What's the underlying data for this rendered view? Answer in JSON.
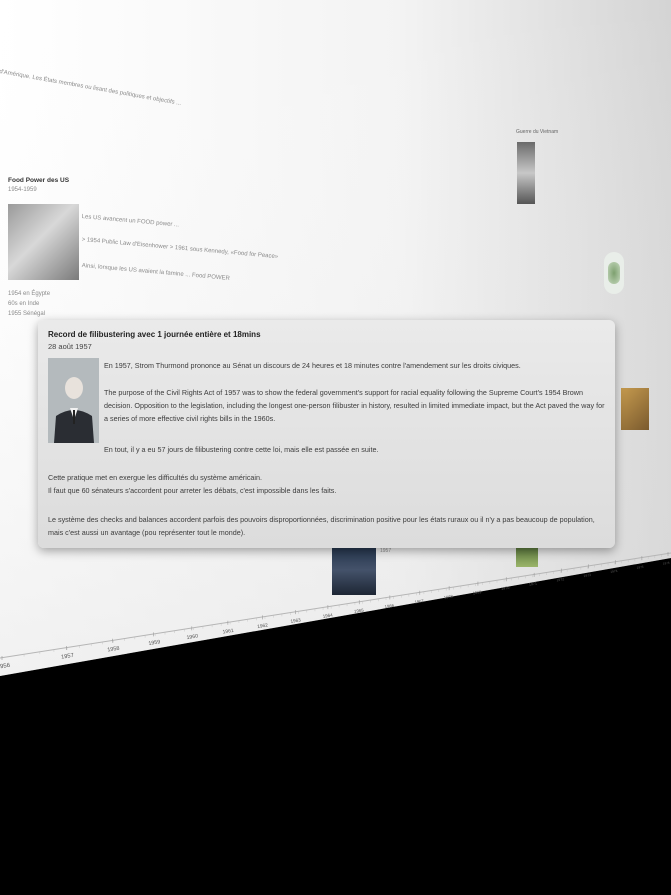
{
  "background": {
    "top_paragraph": "d'Amérique. Les États membres ou lisant des politiques et objectifs ...",
    "section_title": "Food Power des US",
    "section_years": "1954-1959",
    "section_text_1": "Les US avancent un FOOD power ...",
    "section_text_2": "> 1954 Public Law d'Eisenhower > 1961 sous Kennedy, «Food for Peace»",
    "section_text_3": "Ainsi, lorsque les US avaient la famine ... Food POWER",
    "left_list": [
      "1954 en Égypte",
      "60s en Inde",
      "1955 Sénégal"
    ],
    "right_title": "Guerre du Vietnam",
    "right_item_label": "1957"
  },
  "timeline": {
    "years": [
      "1956",
      "1957",
      "1958",
      "1959",
      "1960",
      "1961",
      "1962",
      "1963",
      "1964",
      "1965",
      "1966",
      "1967",
      "1968",
      "1969",
      "1970",
      "1971",
      "1972",
      "1973",
      "1974",
      "1975",
      "1976"
    ]
  },
  "card": {
    "title": "Record de filibustering avec 1 journée entière et 18mins",
    "date": "28 août 1957",
    "photo_icon": "portrait-photo",
    "paragraphs": [
      "En 1957, Strom Thurmond prononce au Sénat un discours de 24 heures et 18 minutes contre l'amendement sur les droits civiques.",
      "The purpose of the Civil Rights Act of 1957 was to show the federal government's support for racial equality following the Supreme Court's 1954 Brown decision. Opposition to the legislation, including the longest one-person filibuster in history, resulted in limited immediate impact, but the Act paved the way for a series of more effective civil rights bills in the 1960s.",
      "En tout, il y a eu 57 jours de filibustering contre cette loi, mais elle est passée en suite.",
      "Cette pratique met en exergue les difficultés du système américain.\nIl faut que 60 sénateurs s'accordent pour arreter les débats, c'est impossible dans les faits.",
      "Le système des checks and balances accordent parfois des pouvoirs disproportionnées, discrimination positive pour les états ruraux ou il n'y a pas beaucoup de population, mais c'est aussi un avantage (pou représenter tout le monde)."
    ]
  }
}
